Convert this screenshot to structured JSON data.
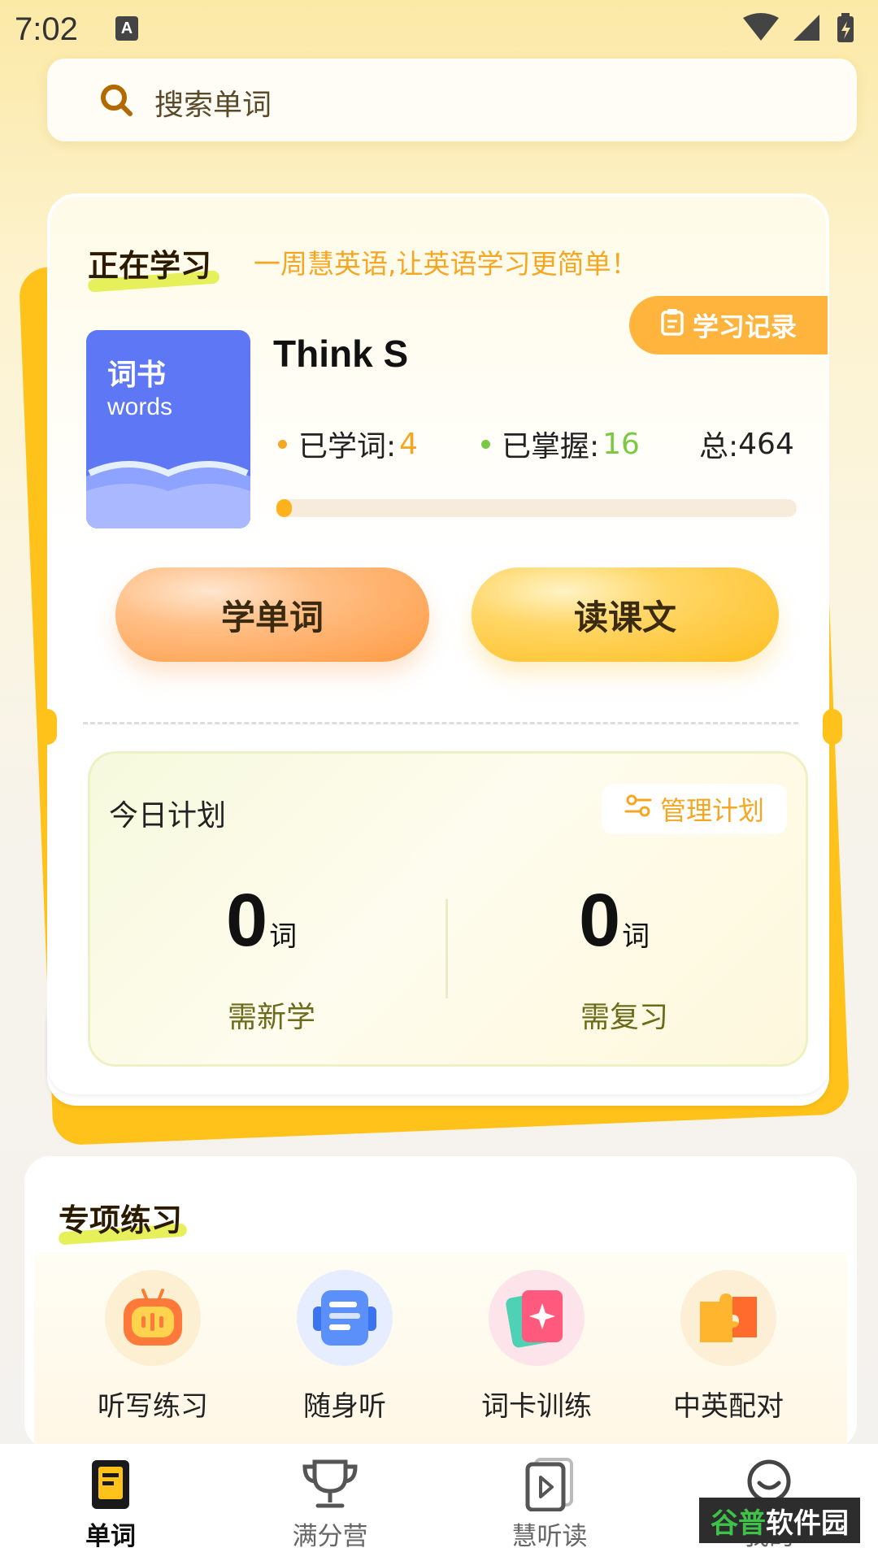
{
  "status_bar": {
    "time": "7:02",
    "badge": "A"
  },
  "search": {
    "placeholder": "搜索单词",
    "icon": "search-icon"
  },
  "learning": {
    "title": "正在学习",
    "slogan": "一周慧英语,让英语学习更简单！",
    "record_button": "学习记录",
    "book": {
      "cover_title": "词书",
      "cover_subtitle": "words",
      "name": "Think S"
    },
    "stats": {
      "learned_label": "已学词:",
      "learned_value": "4",
      "mastered_label": "已掌握:",
      "mastered_value": "16",
      "total_label": "总:",
      "total_value": "464"
    },
    "progress_fraction": 0.02,
    "learn_words_button": "学单词",
    "read_text_button": "读课文"
  },
  "plan": {
    "title": "今日计划",
    "manage_button": "管理计划",
    "new_count": "0",
    "new_unit": "词",
    "new_label": "需新学",
    "review_count": "0",
    "review_unit": "词",
    "review_label": "需复习"
  },
  "practice": {
    "title": "专项练习",
    "items": [
      {
        "label": "听写练习",
        "icon": "robot-icon"
      },
      {
        "label": "随身听",
        "icon": "headphone-icon"
      },
      {
        "label": "词卡训练",
        "icon": "card-icon"
      },
      {
        "label": "中英配对",
        "icon": "puzzle-icon"
      }
    ]
  },
  "tabbar": {
    "items": [
      {
        "label": "单词",
        "icon": "book-icon",
        "active": true
      },
      {
        "label": "满分营",
        "icon": "trophy-icon",
        "active": false
      },
      {
        "label": "慧听读",
        "icon": "play-icon",
        "active": false
      },
      {
        "label": "我的",
        "icon": "smile-icon",
        "active": false
      }
    ]
  },
  "watermark": {
    "green": "谷普",
    "white": "软件园"
  },
  "colors": {
    "accent": "#ffc21a",
    "orange": "#f5a623",
    "green": "#7ac943",
    "book_blue": "#5d77f5"
  }
}
